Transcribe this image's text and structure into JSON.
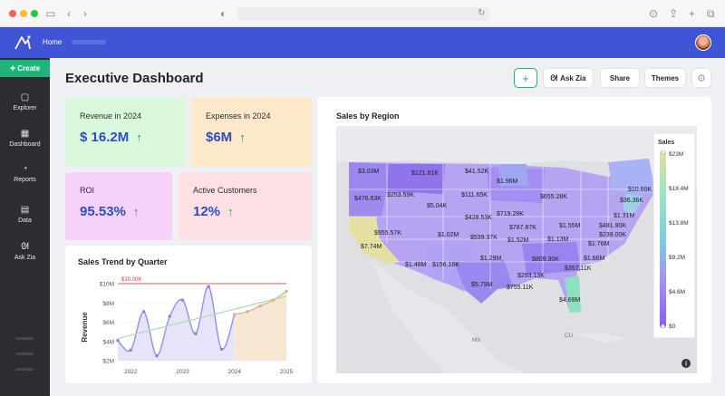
{
  "app": {
    "nav_home": "Home",
    "create_label": "Create",
    "page_title": "Executive Dashboard"
  },
  "sidebar": {
    "items": [
      {
        "label": "Explorer",
        "icon": "folder-icon"
      },
      {
        "label": "Dashboard",
        "icon": "grid-icon"
      },
      {
        "label": "Reports",
        "icon": "pie-chart-icon"
      },
      {
        "label": "Data",
        "icon": "table-icon"
      },
      {
        "label": "Ask Zia",
        "icon": "zia-icon"
      }
    ]
  },
  "toolbar": {
    "add_label": "+",
    "ask_zia_label": "Ask Zia",
    "share_label": "Share",
    "themes_label": "Themes"
  },
  "kpis": [
    {
      "label": "Revenue in 2024",
      "value": "$ 16.2M",
      "color": "#dcf8dc"
    },
    {
      "label": "Expenses in 2024",
      "value": "$6M",
      "color": "#fde9c9"
    },
    {
      "label": "ROI",
      "value": "95.53%",
      "color": "#f6d1f9"
    },
    {
      "label": "Active Customers",
      "value": "12%",
      "color": "#fce0e4"
    }
  ],
  "trend": {
    "title": "Sales Trend by Quarter",
    "ylabel": "Revenue",
    "target_label": "$10.00K"
  },
  "map": {
    "title": "Sales by Region",
    "legend_title": "Sales",
    "legend_ticks": [
      "$23M",
      "$18.4M",
      "$13.8M",
      "$9.2M",
      "$4.6M",
      "$0"
    ],
    "region_labels": [
      "MX",
      "CU"
    ],
    "labels": [
      {
        "text": "$3.03M"
      },
      {
        "text": "$121.81K"
      },
      {
        "text": "$41.52K"
      },
      {
        "text": "$1.96M"
      },
      {
        "text": "$476.63K"
      },
      {
        "text": "$253.59K"
      },
      {
        "text": "$111.65K"
      },
      {
        "text": "$655.28K"
      },
      {
        "text": "$10.60K"
      },
      {
        "text": "$5.04K"
      },
      {
        "text": "$36.36K"
      },
      {
        "text": "$428.53K"
      },
      {
        "text": "$719.28K"
      },
      {
        "text": "$1.31M"
      },
      {
        "text": "$787.87K"
      },
      {
        "text": "$1.55M"
      },
      {
        "text": "$955.57K"
      },
      {
        "text": "$1.02M"
      },
      {
        "text": "$539.37K"
      },
      {
        "text": "$1.52M"
      },
      {
        "text": "$1.13M"
      },
      {
        "text": "$481.90K"
      },
      {
        "text": "$239.00K"
      },
      {
        "text": "$7.74M"
      },
      {
        "text": "$1.76M"
      },
      {
        "text": "$1.29M"
      },
      {
        "text": "$809.30K"
      },
      {
        "text": "$1.66M"
      },
      {
        "text": "$1.48M"
      },
      {
        "text": "$156.16K"
      },
      {
        "text": "$293.13K"
      },
      {
        "text": "$357.11K"
      },
      {
        "text": "$5.79M"
      },
      {
        "text": "$755.11K"
      },
      {
        "text": "$4.69M"
      }
    ]
  },
  "chart_data": {
    "type": "line",
    "title": "Sales Trend by Quarter",
    "xlabel": "",
    "ylabel": "Revenue",
    "x_ticks": [
      "2022",
      "2023",
      "2024",
      "2025"
    ],
    "y_ticks": [
      "$2M",
      "$4M",
      "$6M",
      "$8M",
      "$10M"
    ],
    "ylim": [
      2,
      10
    ],
    "target_line": {
      "label": "$10.00K",
      "value": 10.0
    },
    "series": [
      {
        "x": [
          2021.75,
          2022.0,
          2022.25,
          2022.5,
          2022.75,
          2023.0,
          2023.25,
          2023.5,
          2023.75,
          2024.0,
          2024.25,
          2024.5,
          2024.75,
          2025.0
        ],
        "values": [
          4.1,
          3.1,
          7.1,
          2.5,
          6.6,
          8.3,
          4.8,
          9.7,
          3.2,
          6.8,
          7.1,
          7.7,
          8.3,
          9.2
        ]
      }
    ],
    "trendline": {
      "x": [
        2021.75,
        2025.0
      ],
      "values": [
        4.3,
        8.7
      ]
    },
    "forecast_from": 2024.0
  }
}
